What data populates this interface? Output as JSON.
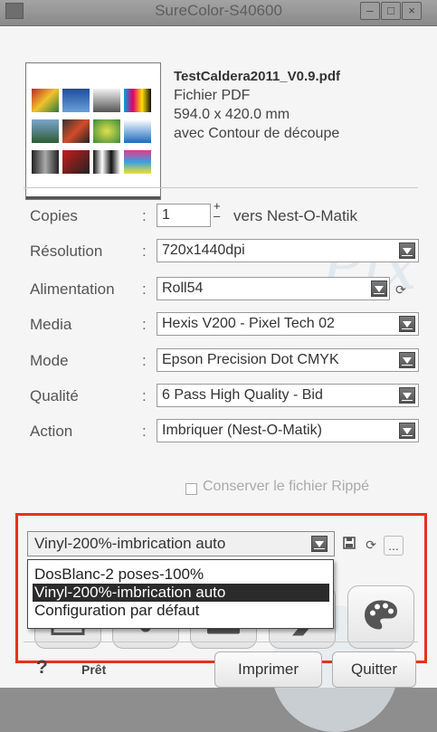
{
  "window": {
    "title": "SureColor-S40600"
  },
  "file": {
    "name": "TestCaldera2011_V0.9.pdf",
    "type": "Fichier PDF",
    "size": "594.0 x 420.0 mm",
    "contour": "avec Contour de découpe"
  },
  "settings": {
    "copies_label": "Copies",
    "copies_value": "1",
    "copies_target": "vers Nest-O-Matik",
    "resolution_label": "Résolution",
    "resolution_value": "720x1440dpi",
    "feed_label": "Alimentation",
    "feed_value": "Roll54",
    "media_label": "Media",
    "media_value": "Hexis V200 - Pixel Tech 02",
    "mode_label": "Mode",
    "mode_value": "Epson Precision Dot CMYK",
    "quality_label": "Qualité",
    "quality_value": "6 Pass High Quality - Bid",
    "action_label": "Action",
    "action_value": "Imbriquer (Nest-O-Matik)",
    "keep_rip_label": "Conserver le fichier Rippé",
    "colon": ":"
  },
  "preset": {
    "selected": "Vinyl-200%-imbrication auto",
    "options": [
      "DosBlanc-2 poses-100%",
      "Vinyl-200%-imbrication auto",
      "Configuration par défaut"
    ],
    "selected_index": 1,
    "more_label": "..."
  },
  "footer": {
    "help": "?",
    "status": "Prêt",
    "print_label": "Imprimer",
    "quit_label": "Quitter"
  },
  "icons": {
    "save": "floppy-icon",
    "refresh": "refresh-icon",
    "palette": "palette-icon"
  },
  "colors": {
    "highlight_frame": "#e53319",
    "selection": "#2b2b2b"
  },
  "watermark": {
    "text": "Pix"
  }
}
